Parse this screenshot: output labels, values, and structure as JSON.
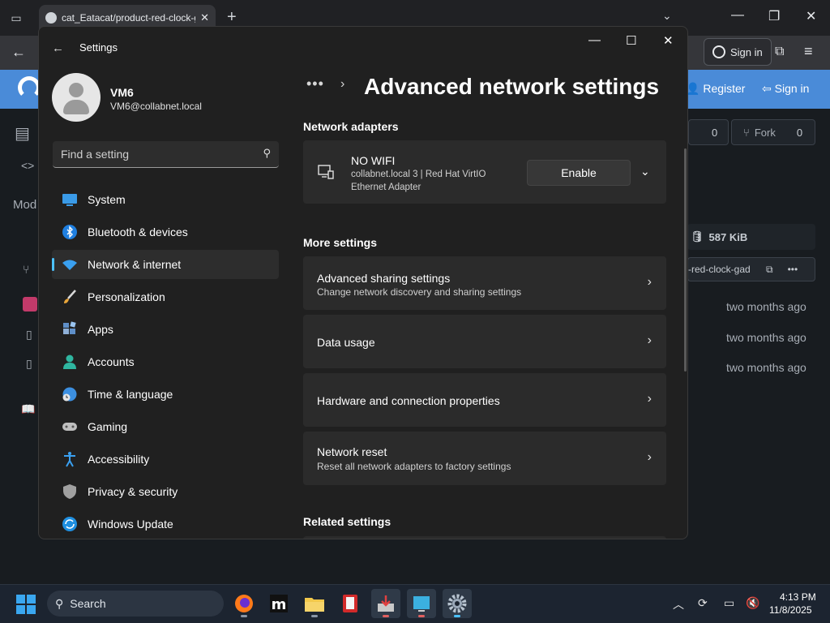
{
  "browser": {
    "tab_title": "cat_Eatacat/product-red-clock-g",
    "tab_close": "✕",
    "new_tab": "+",
    "sign_in": "Sign in"
  },
  "website": {
    "register": "Register",
    "sign_in": "Sign in",
    "star_count": "0",
    "fork_label": "Fork",
    "fork_count": "0",
    "left_label": "Mod",
    "repo_size": "587 KiB",
    "branch_fragment": "-red-clock-gad",
    "times": [
      "two months ago",
      "two months ago",
      "two months ago"
    ]
  },
  "settings": {
    "window_title": "Settings",
    "profile": {
      "name": "VM6",
      "email": "VM6@collabnet.local"
    },
    "search_placeholder": "Find a setting",
    "nav": [
      {
        "label": "System",
        "icon": "system-icon"
      },
      {
        "label": "Bluetooth & devices",
        "icon": "bluetooth-icon"
      },
      {
        "label": "Network & internet",
        "icon": "network-icon",
        "selected": true
      },
      {
        "label": "Personalization",
        "icon": "brush-icon"
      },
      {
        "label": "Apps",
        "icon": "apps-icon"
      },
      {
        "label": "Accounts",
        "icon": "accounts-icon"
      },
      {
        "label": "Time & language",
        "icon": "globe-clock-icon"
      },
      {
        "label": "Gaming",
        "icon": "gamepad-icon"
      },
      {
        "label": "Accessibility",
        "icon": "accessibility-icon"
      },
      {
        "label": "Privacy & security",
        "icon": "shield-icon"
      },
      {
        "label": "Windows Update",
        "icon": "update-icon"
      }
    ],
    "breadcrumb_more": "•••",
    "page_title": "Advanced network settings",
    "network_adapters_title": "Network adapters",
    "adapter": {
      "name": "NO WIFI",
      "description": "collabnet.local 3 | Red Hat VirtIO Ethernet Adapter",
      "button": "Enable"
    },
    "more_settings_title": "More settings",
    "more_settings": [
      {
        "title": "Advanced sharing settings",
        "subtitle": "Change network discovery and sharing settings"
      },
      {
        "title": "Data usage",
        "subtitle": ""
      },
      {
        "title": "Hardware and connection properties",
        "subtitle": ""
      },
      {
        "title": "Network reset",
        "subtitle": "Reset all network adapters to factory settings"
      }
    ],
    "related_settings_title": "Related settings"
  },
  "taskbar": {
    "search_label": "Search",
    "time": "4:13 PM",
    "date": "11/8/2025"
  },
  "colors": {
    "accent": "#4cc2ff",
    "site_header": "#4a8bd8",
    "settings_bg": "#202020",
    "card_bg": "#2b2b2b"
  }
}
